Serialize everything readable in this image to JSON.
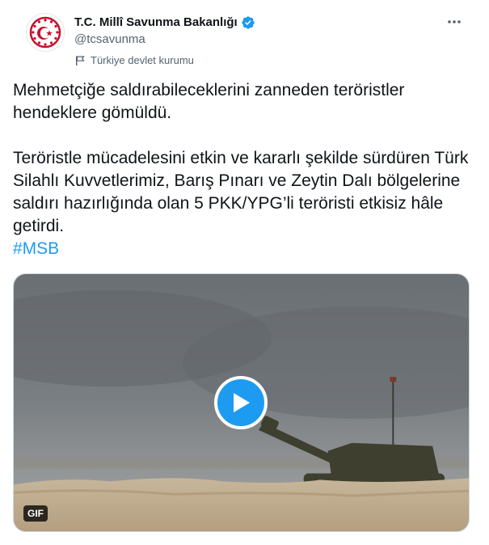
{
  "account": {
    "display_name": "T.C. Millî Savunma Bakanlığı",
    "handle": "@tcsavunma",
    "label": "Türkiye devlet kurumu",
    "verified": true,
    "verified_color": "#1d9bf0",
    "avatar_icon": "turkish-crescent-star-seal-icon"
  },
  "tweet": {
    "line1": "Mehmetçiğe saldırabileceklerini zanneden teröristler hendeklere gömüldü.",
    "line2": "Teröristle mücadelesini etkin ve kararlı şekilde sürdüren Türk Silahlı Kuvvetlerimiz, Barış Pınarı ve Zeytin Dalı bölgelerine saldırı hazırlığında olan 5 PKK/YPG’li teröristi etkisiz hâle getirdi.",
    "hashtag": "#MSB",
    "link_color": "#1d9bf0"
  },
  "media": {
    "type": "gif",
    "badge": "GIF",
    "play_icon": "play-icon",
    "play_color": "#1d9bf0"
  },
  "icons": {
    "more": "more-horizontal-icon",
    "label": "flag-icon"
  }
}
